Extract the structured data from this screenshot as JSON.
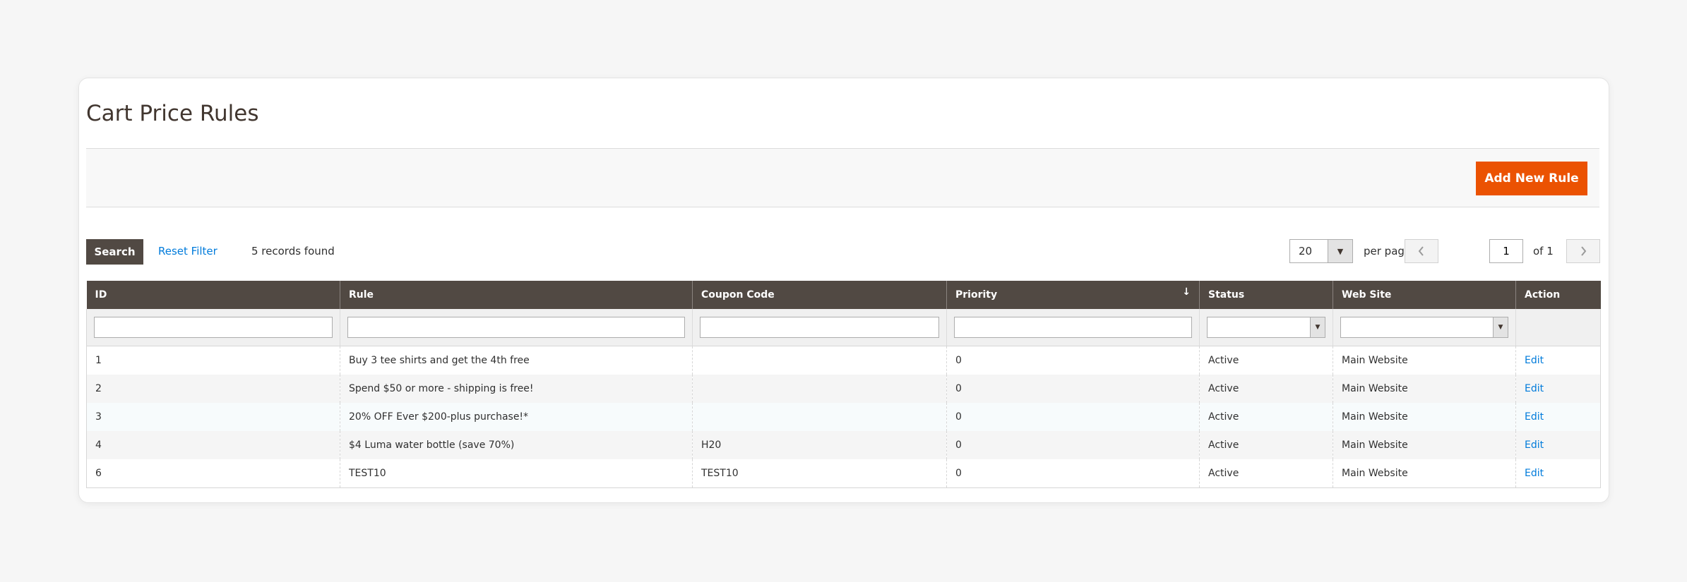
{
  "page": {
    "title": "Cart Price Rules"
  },
  "actions": {
    "add_new_rule_label": "Add New Rule"
  },
  "toolbar": {
    "search_label": "Search",
    "reset_filter_label": "Reset Filter",
    "records_found": "5 records found",
    "per_page_value": "20",
    "per_page_label": "per page",
    "current_page": "1",
    "page_of": "of 1"
  },
  "grid": {
    "columns": [
      "ID",
      "Rule",
      "Coupon Code",
      "Priority",
      "Status",
      "Web Site",
      "Action"
    ],
    "sorted_column": "Priority",
    "rows": [
      {
        "id": "1",
        "rule": "Buy 3 tee shirts and get the 4th free",
        "coupon": "",
        "priority": "0",
        "status": "Active",
        "website": "Main Website",
        "action": "Edit"
      },
      {
        "id": "2",
        "rule": "Spend $50 or more - shipping is free!",
        "coupon": "",
        "priority": "0",
        "status": "Active",
        "website": "Main Website",
        "action": "Edit"
      },
      {
        "id": "3",
        "rule": "20% OFF Ever $200-plus purchase!*",
        "coupon": "",
        "priority": "0",
        "status": "Active",
        "website": "Main Website",
        "action": "Edit"
      },
      {
        "id": "4",
        "rule": "$4 Luma water bottle (save 70%)",
        "coupon": "H20",
        "priority": "0",
        "status": "Active",
        "website": "Main Website",
        "action": "Edit"
      },
      {
        "id": "6",
        "rule": "TEST10",
        "coupon": "TEST10",
        "priority": "0",
        "status": "Active",
        "website": "Main Website",
        "action": "Edit"
      }
    ]
  },
  "colors": {
    "accent": "#eb5202",
    "header_bg": "#514943",
    "link": "#007bdb"
  },
  "icons": {
    "sort": "arrow-down-icon",
    "prev": "chevron-left-icon",
    "next": "chevron-right-icon",
    "dropdown": "caret-down-icon"
  }
}
